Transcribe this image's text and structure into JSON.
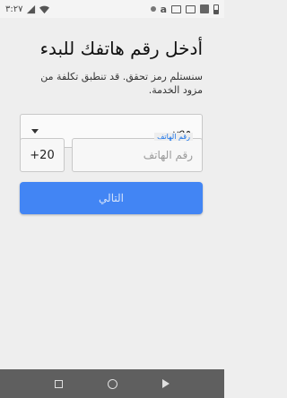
{
  "status_bar": {
    "time": "٣:٢٧",
    "icons": [
      "signal-icon",
      "wifi-icon",
      "notification-square-icon",
      "screen-icon",
      "square-outline-icon",
      "amazon-icon",
      "dot-icon",
      "battery-icon"
    ],
    "amazon_glyph": "a"
  },
  "header": {
    "title": "أدخل رقم هاتفك للبدء",
    "subtitle": "سنستلم رمز تحقق. قد تنطبق تكلفة من مزود الخدمة."
  },
  "form": {
    "country_value": "مصر",
    "country_code": "+20",
    "phone_label": "رقم الهاتف",
    "phone_placeholder": "رقم الهاتف",
    "phone_value": ""
  },
  "actions": {
    "next_label": "التالي",
    "accent_color": "#4285f4"
  },
  "nav": {
    "icons": [
      "recent-apps-icon",
      "home-icon",
      "back-icon"
    ]
  }
}
